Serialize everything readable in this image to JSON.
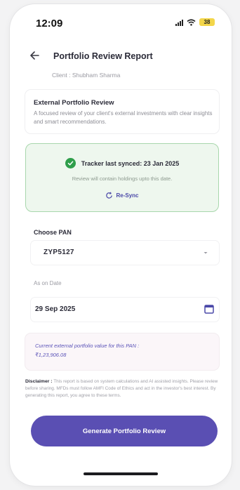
{
  "status_bar": {
    "time": "12:09",
    "battery": "38"
  },
  "header": {
    "title": "Portfolio Review Report"
  },
  "client": {
    "text": "Client : Shubham Sharma"
  },
  "external_card": {
    "title": "External Portfolio Review",
    "description": "A focused review of your client's external investments with clear insights and smart recommendations."
  },
  "sync": {
    "title": "Tracker last synced: 23 Jan 2025",
    "subtitle": "Review will contain holdings upto this date.",
    "resync_label": "Re-Sync"
  },
  "pan": {
    "label": "Choose PAN",
    "value": "ZYP5127"
  },
  "as_on_date": {
    "label": "As on Date",
    "value": "29 Sep 2025"
  },
  "value_card": {
    "line1": "Current external portfolio value for this PAN :",
    "line2": "₹1,23,906.08"
  },
  "disclaimer": {
    "label": "Disclaimer :",
    "text": "This report is based on system calculations and AI assisted insights. Please review before sharing. MFDs must follow AMFI Code of Ethics and act in the investor's best interest. By generating this report, you agree to these terms."
  },
  "generate_button": {
    "label": "Generate Portfolio Review"
  },
  "colors": {
    "accent": "#5a4fb3",
    "sync_bg": "#eef7ee",
    "sync_border": "#a8d7ac",
    "check": "#2e9e4a"
  }
}
